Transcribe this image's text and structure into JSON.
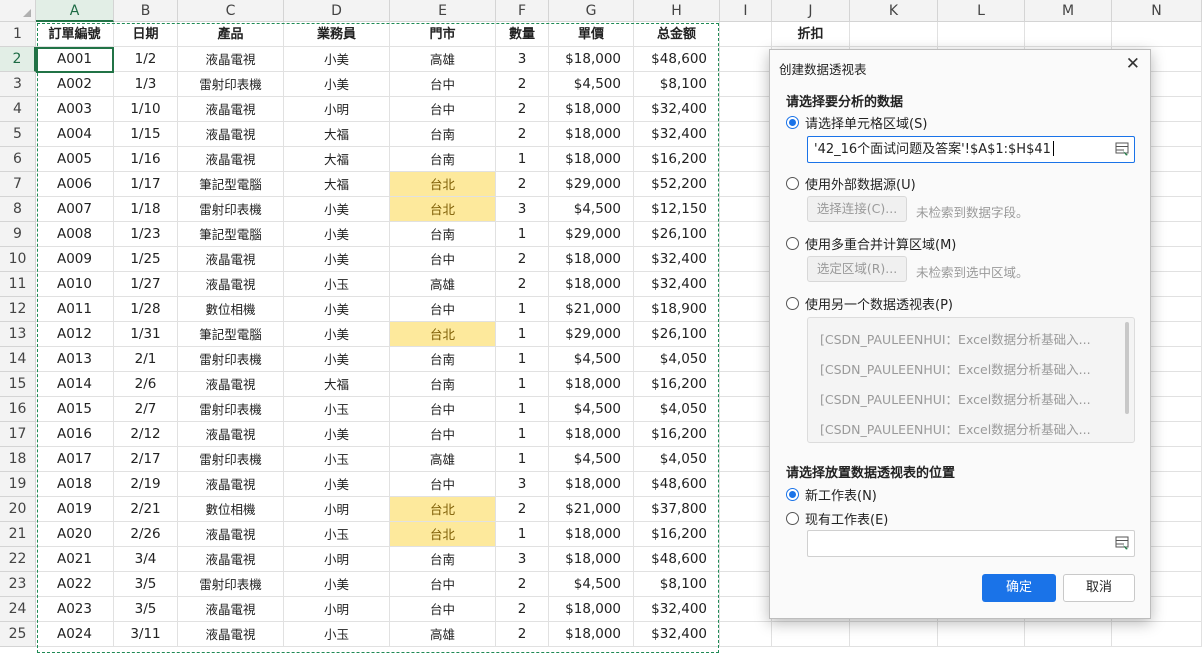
{
  "spreadsheet": {
    "columns": [
      "A",
      "B",
      "C",
      "D",
      "E",
      "F",
      "G",
      "H",
      "I",
      "J",
      "K",
      "L",
      "M",
      "N"
    ],
    "selected_column": "A",
    "selected_row": 2,
    "header_row": [
      "訂單編號",
      "日期",
      "產品",
      "業務員",
      "門市",
      "數量",
      "單價",
      "总金额",
      "",
      "折扣"
    ],
    "rows": [
      [
        "A001",
        "1/2",
        "液晶電視",
        "小美",
        "高雄",
        "3",
        "$18,000",
        "$48,600"
      ],
      [
        "A002",
        "1/3",
        "雷射印表機",
        "小美",
        "台中",
        "2",
        "$4,500",
        "$8,100"
      ],
      [
        "A003",
        "1/10",
        "液晶電視",
        "小明",
        "台中",
        "2",
        "$18,000",
        "$32,400"
      ],
      [
        "A004",
        "1/15",
        "液晶電視",
        "大福",
        "台南",
        "2",
        "$18,000",
        "$32,400"
      ],
      [
        "A005",
        "1/16",
        "液晶電視",
        "大福",
        "台南",
        "1",
        "$18,000",
        "$16,200"
      ],
      [
        "A006",
        "1/17",
        "筆記型電腦",
        "大福",
        "台北",
        "2",
        "$29,000",
        "$52,200"
      ],
      [
        "A007",
        "1/18",
        "雷射印表機",
        "小美",
        "台北",
        "3",
        "$4,500",
        "$12,150"
      ],
      [
        "A008",
        "1/23",
        "筆記型電腦",
        "小美",
        "台南",
        "1",
        "$29,000",
        "$26,100"
      ],
      [
        "A009",
        "1/25",
        "液晶電視",
        "小美",
        "台中",
        "2",
        "$18,000",
        "$32,400"
      ],
      [
        "A010",
        "1/27",
        "液晶電視",
        "小玉",
        "高雄",
        "2",
        "$18,000",
        "$32,400"
      ],
      [
        "A011",
        "1/28",
        "數位相機",
        "小美",
        "台中",
        "1",
        "$21,000",
        "$18,900"
      ],
      [
        "A012",
        "1/31",
        "筆記型電腦",
        "小美",
        "台北",
        "1",
        "$29,000",
        "$26,100"
      ],
      [
        "A013",
        "2/1",
        "雷射印表機",
        "小美",
        "台南",
        "1",
        "$4,500",
        "$4,050"
      ],
      [
        "A014",
        "2/6",
        "液晶電視",
        "大福",
        "台南",
        "1",
        "$18,000",
        "$16,200"
      ],
      [
        "A015",
        "2/7",
        "雷射印表機",
        "小玉",
        "台中",
        "1",
        "$4,500",
        "$4,050"
      ],
      [
        "A016",
        "2/12",
        "液晶電視",
        "小美",
        "台中",
        "1",
        "$18,000",
        "$16,200"
      ],
      [
        "A017",
        "2/17",
        "雷射印表機",
        "小玉",
        "高雄",
        "1",
        "$4,500",
        "$4,050"
      ],
      [
        "A018",
        "2/19",
        "液晶電視",
        "小美",
        "台中",
        "3",
        "$18,000",
        "$48,600"
      ],
      [
        "A019",
        "2/21",
        "數位相機",
        "小明",
        "台北",
        "2",
        "$21,000",
        "$37,800"
      ],
      [
        "A020",
        "2/26",
        "液晶電視",
        "小玉",
        "台北",
        "1",
        "$18,000",
        "$16,200"
      ],
      [
        "A021",
        "3/4",
        "液晶電視",
        "小明",
        "台南",
        "3",
        "$18,000",
        "$48,600"
      ],
      [
        "A022",
        "3/5",
        "雷射印表機",
        "小美",
        "台中",
        "2",
        "$4,500",
        "$8,100"
      ],
      [
        "A023",
        "3/5",
        "液晶電視",
        "小明",
        "台中",
        "2",
        "$18,000",
        "$32,400"
      ],
      [
        "A024",
        "3/11",
        "液晶電視",
        "小玉",
        "高雄",
        "2",
        "$18,000",
        "$32,400"
      ]
    ],
    "highlight_value": "台北",
    "highlight_color": "#fde99c"
  },
  "dialog": {
    "title": "创建数据透视表",
    "section1_title": "请选择要分析的数据",
    "opt_range_label": "请选择单元格区域(S)",
    "range_value": "'42_16个面试问题及答案'!$A$1:$H$41",
    "opt_external_label": "使用外部数据源(U)",
    "btn_select_connection": "选择连接(C)...",
    "hint_no_fields": "未检索到数据字段。",
    "opt_multi_label": "使用多重合并计算区域(M)",
    "btn_select_area": "选定区域(R)...",
    "hint_no_area": "未检索到选中区域。",
    "opt_pivot_label": "使用另一个数据透视表(P)",
    "pivot_list": [
      "[CSDN_PAULEENHUI：Excel数据分析基础入...",
      "[CSDN_PAULEENHUI：Excel数据分析基础入...",
      "[CSDN_PAULEENHUI：Excel数据分析基础入...",
      "[CSDN_PAULEENHUI：Excel数据分析基础入..."
    ],
    "section2_title": "请选择放置数据透视表的位置",
    "opt_new_sheet_label": "新工作表(N)",
    "opt_existing_sheet_label": "现有工作表(E)",
    "existing_sheet_value": "",
    "ok_label": "确定",
    "cancel_label": "取消",
    "accent_color": "#1a73e8"
  }
}
